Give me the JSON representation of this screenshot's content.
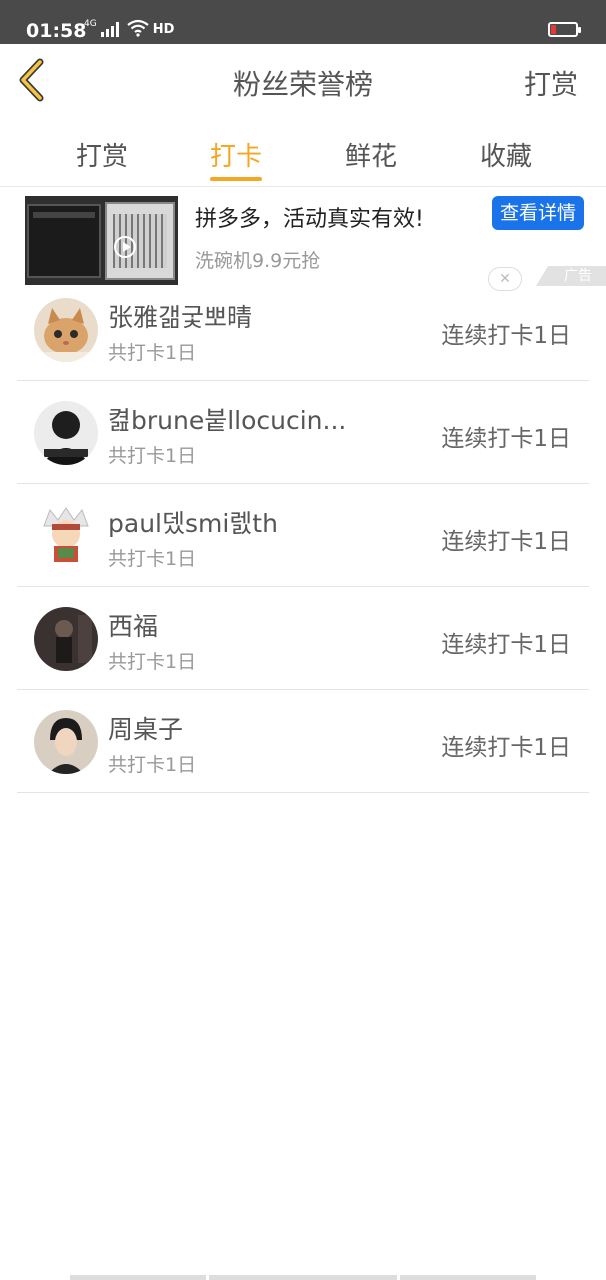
{
  "status_bar": {
    "time": "01:58",
    "network": "4G",
    "hd": "HD"
  },
  "nav": {
    "title": "粉丝荣誉榜",
    "right_action": "打赏"
  },
  "tabs": [
    {
      "label": "打赏",
      "active": false
    },
    {
      "label": "打卡",
      "active": true
    },
    {
      "label": "鲜花",
      "active": false
    },
    {
      "label": "收藏",
      "active": false
    }
  ],
  "ad": {
    "title": "拼多多，活动真实有效!",
    "subtitle": "洗碗机9.9元抢",
    "button": "查看详情",
    "close": "✕",
    "tag": "广告"
  },
  "rows": [
    {
      "name": "张雅갦궃뽀晴",
      "total": "共打卡1日",
      "streak": "连续打卡1日",
      "avatar": "kitten"
    },
    {
      "name": "켪brune붙llocucin...",
      "total": "共打卡1日",
      "streak": "连续打卡1日",
      "avatar": "dark-portrait"
    },
    {
      "name": "paul뎄smi렔th",
      "total": "共打卡1日",
      "streak": "连续打卡1日",
      "avatar": "cartoon-ninja"
    },
    {
      "name": "西福",
      "total": "共打卡1日",
      "streak": "连续打卡1日",
      "avatar": "dark-person"
    },
    {
      "name": "周桌子",
      "total": "共打卡1日",
      "streak": "连续打卡1日",
      "avatar": "person-portrait"
    }
  ],
  "colors": {
    "accent": "#f5a623",
    "ad_button": "#1a73e8",
    "status_bar": "#4a4a4a"
  }
}
